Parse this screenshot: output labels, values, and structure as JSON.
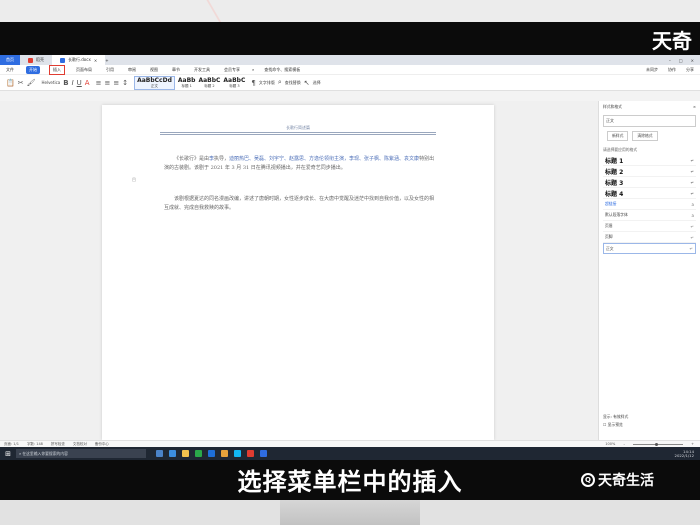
{
  "overlay": {
    "brand_top": "天奇",
    "caption": "选择菜单栏中的插入",
    "brand_bottom": "天奇生活"
  },
  "tabs": {
    "home": "首页",
    "docer": "稻壳",
    "document": "长歌行.docx"
  },
  "menu": {
    "items": [
      "文件",
      "开始",
      "插入",
      "页面布局",
      "引用",
      "审阅",
      "视图",
      "章节",
      "开发工具",
      "会员专享"
    ],
    "search_placeholder": "查找命令、搜索模板",
    "right": [
      "未同步",
      "协作",
      "分享"
    ]
  },
  "ribbon": {
    "font": "Helvetica",
    "styles": [
      {
        "sample": "AaBbCcDd",
        "name": "正文"
      },
      {
        "sample": "AaBb",
        "name": "标题 1"
      },
      {
        "sample": "AaBbC",
        "name": "标题 2"
      },
      {
        "sample": "AaBbC",
        "name": "标题 3"
      }
    ],
    "text_tools": "文字排版",
    "find_replace": "查找替换",
    "select": "选择"
  },
  "document": {
    "header": "长歌行简述篇",
    "para1_lead": "《长歌行》是由",
    "para1_director": "李",
    "para1_rest": "执导，",
    "para1_cast": "迪丽热巴、吴磊、刘宇宁、赵露思、方逸伦领衔主演，李现、张子枫、陈紫涵、袁文康",
    "para1_tail": "特别出演的古装剧。该剧于 2021 年 3 月 31 日在腾讯视频播出，并在爱奇艺同步播出。",
    "para2": "该剧根据夏达的同名漫画改编，讲述了唐朝时期，女性逐步成长、在大唐中觉醒及迷茫中找到自我价值，以及女性的相互成就、完成自我救赎的故事。"
  },
  "pane": {
    "title": "样式和格式",
    "current": "正文",
    "new_style": "新样式",
    "clear_format": "清除格式",
    "subtitle": "请选择要应用的格式",
    "styles": [
      "标题 1",
      "标题 2",
      "标题 3",
      "标题 4",
      "超链接",
      "默认段落字体",
      "页眉",
      "页脚",
      "正文"
    ],
    "show_label": "显示: 有效样式",
    "preview": "显示预览"
  },
  "status": {
    "page": "页面: 1/1",
    "words": "字数: 148",
    "spell": "拼写检查",
    "proof": "文档校对",
    "backup": "备份中心",
    "zoom": "100%"
  },
  "taskbar": {
    "search": "在这里输入你要搜索的内容",
    "time": "14:14",
    "date": "2022/1/12"
  },
  "colors": {
    "accent": "#2f6de1",
    "highlight_outline": "#e03c31",
    "taskbar": "#1f2733"
  }
}
